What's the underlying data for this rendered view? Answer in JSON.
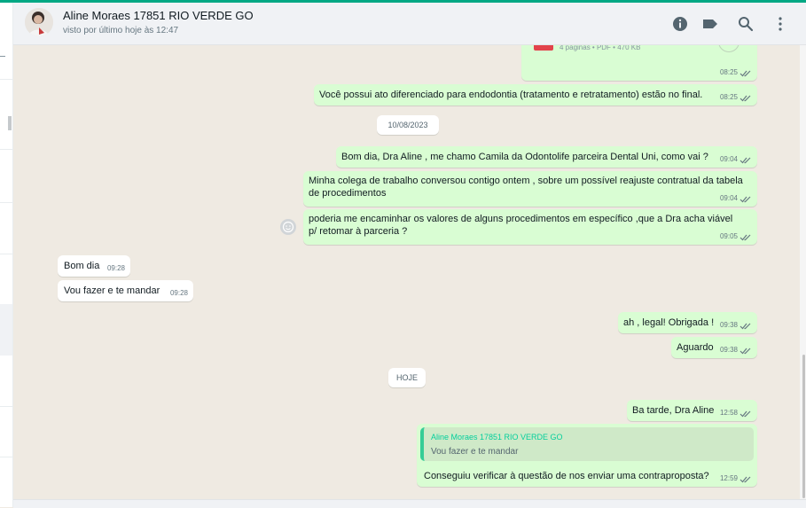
{
  "header": {
    "contact_name": "Aline Moraes 17851 RIO VERDE GO",
    "status": "visto por último hoje às 12:47"
  },
  "icons": {
    "info": "info-icon",
    "label": "label-icon",
    "search": "search-icon",
    "menu": "more-vertical-icon",
    "ticks": "double-check-icon",
    "emoji": "smiley-icon"
  },
  "colors": {
    "accent": "#00a884",
    "outgoing_bubble": "#d9fdd3",
    "incoming_bubble": "#ffffff",
    "chat_background": "#efeae2",
    "quote_name": "#06cf9c"
  },
  "messages": {
    "m0": {
      "doc_meta": "4 páginas • PDF • 470 KB",
      "time": "08:25"
    },
    "m1": {
      "text": "Você possui ato diferenciado para endodontia (tratamento e retratamento) estão no final.",
      "time": "08:25"
    },
    "date1": "10/08/2023",
    "m2": {
      "text": "Bom dia, Dra Aline , me chamo Camila da Odontolife parceira Dental Uni, como vai ?",
      "time": "09:04"
    },
    "m3": {
      "text": "Minha colega de trabalho conversou contigo ontem , sobre um possível reajuste contratual da tabela de procedimentos",
      "time": "09:04"
    },
    "m4": {
      "text": "poderia me encaminhar os valores de alguns procedimentos em específico ,que a Dra acha viável p/ retomar à parceria ?",
      "time": "09:05"
    },
    "m5": {
      "text": "Bom dia",
      "time": "09:28"
    },
    "m6": {
      "text": "Vou  fazer e te mandar",
      "time": "09:28"
    },
    "m7": {
      "text": "ah , legal! Obrigada !",
      "time": "09:38"
    },
    "m8": {
      "text": "Aguardo",
      "time": "09:38"
    },
    "date2": "HOJE",
    "m9": {
      "text": "Ba tarde, Dra Aline",
      "time": "12:58"
    },
    "m10": {
      "quote_name": "Aline Moraes 17851 RIO VERDE GO",
      "quote_text": "Vou  fazer e te mandar",
      "text": "Conseguiu verificar à questão de nos enviar uma contraproposta?",
      "time": "12:59"
    }
  }
}
